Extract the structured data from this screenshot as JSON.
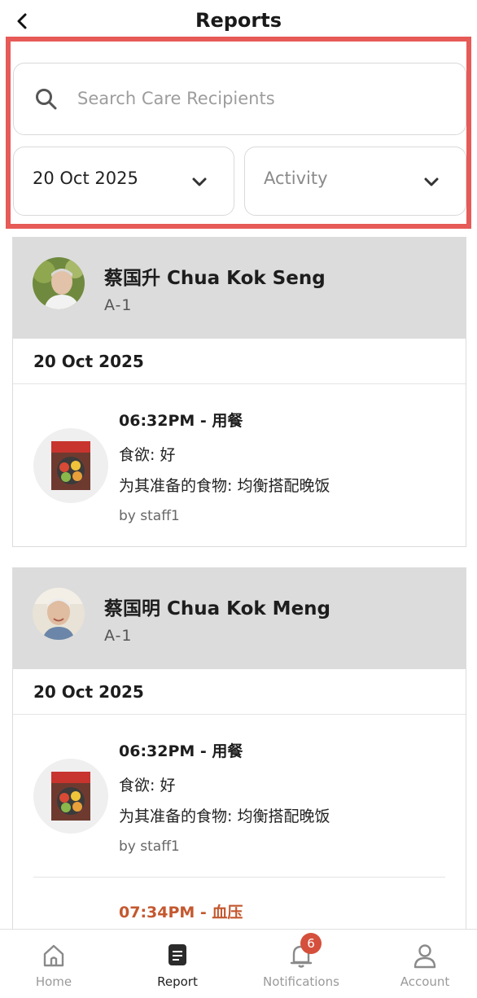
{
  "header": {
    "title": "Reports",
    "back_icon": "chevron-left-icon"
  },
  "filters": {
    "search": {
      "placeholder": "Search Care Recipients",
      "value": "",
      "icon": "search-icon"
    },
    "date_select": {
      "value": "20 Oct 2025",
      "icon": "chevron-down-icon"
    },
    "activity_select": {
      "value": "Activity",
      "icon": "chevron-down-icon"
    },
    "highlight_color": "#e65a57"
  },
  "reports": [
    {
      "name": "蔡国升 Chua Kok Seng",
      "room": "A-1",
      "date": "20 Oct 2025",
      "entries": [
        {
          "title": "06:32PM - 用餐",
          "line1": "食欲: 好",
          "line2": "为其准备的食物: 均衡搭配晚饭",
          "by": "by staff1",
          "icon": "meal-icon"
        }
      ]
    },
    {
      "name": "蔡国明 Chua Kok Meng",
      "room": "A-1",
      "date": "20 Oct 2025",
      "entries": [
        {
          "title": "06:32PM - 用餐",
          "line1": "食欲: 好",
          "line2": "为其准备的食物: 均衡搭配晚饭",
          "by": "by staff1",
          "icon": "meal-icon"
        },
        {
          "title": "07:34PM - 血压",
          "accent": "#c4582f"
        }
      ]
    }
  ],
  "bottom_nav": {
    "items": [
      {
        "label": "Home",
        "icon": "home-icon",
        "active": false
      },
      {
        "label": "Report",
        "icon": "report-icon",
        "active": true
      },
      {
        "label": "Notifications",
        "icon": "bell-icon",
        "active": false,
        "badge": "6"
      },
      {
        "label": "Account",
        "icon": "user-icon",
        "active": false
      }
    ]
  },
  "colors": {
    "card_header_bg": "#dcdcdc",
    "badge": "#d4503c",
    "alert_text": "#c4582f"
  }
}
